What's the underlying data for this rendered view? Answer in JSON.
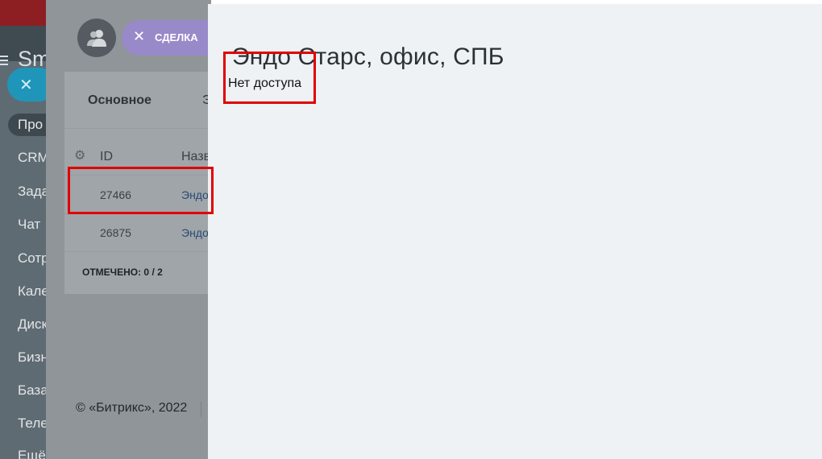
{
  "left_nav": {
    "logo": "Sm",
    "active_item": "Про",
    "items": [
      "CRM",
      "Зада",
      "Чат",
      "Сотр",
      "Кале",
      "Диск",
      "Бизн",
      "База",
      "Теле",
      "Ещё"
    ]
  },
  "header": {
    "deal_chip": "СДЕЛКА"
  },
  "tabs": {
    "main": "Основное",
    "second": "Э"
  },
  "grid": {
    "col_id": "ID",
    "col_name": "Назв",
    "rows": [
      {
        "id": "27466",
        "name": "Эндо"
      },
      {
        "id": "26875",
        "name": "Эндо"
      }
    ],
    "selected": "ОТМЕЧЕНО: 0 / 2"
  },
  "footer": {
    "copyright": "© «Битрикс», 2022"
  },
  "panel": {
    "title": "Эндо Старс, офис, СПБ",
    "message": "Нет доступа"
  },
  "colors": {
    "highlight": "#e00000",
    "deal_chip": "#9889c9",
    "panel_bg": "#eef2f4"
  }
}
